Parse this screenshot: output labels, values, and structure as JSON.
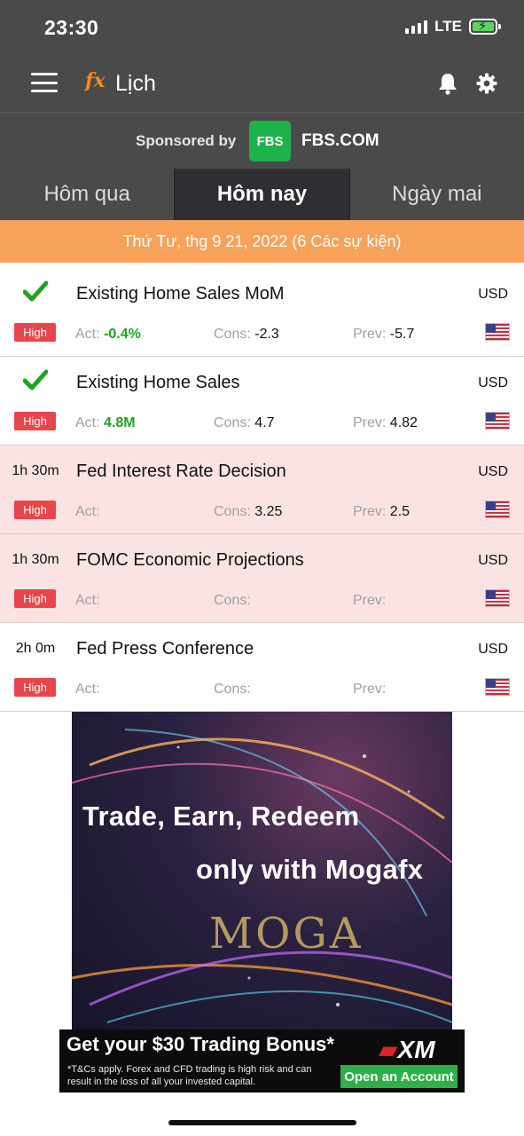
{
  "status_bar": {
    "time": "23:30",
    "network": "LTE"
  },
  "header": {
    "logo": "fx",
    "title": "Lịch"
  },
  "sponsor": {
    "text": "Sponsored by",
    "logo": "FBS",
    "name": "FBS.COM"
  },
  "tabs": [
    {
      "label": "Hôm qua",
      "active": false
    },
    {
      "label": "Hôm nay",
      "active": true
    },
    {
      "label": "Ngày mai",
      "active": false
    }
  ],
  "date_banner": "Thứ Tư, thg 9 21, 2022 (6 Các sự kiện)",
  "stat_labels": {
    "act": "Act:",
    "cons": "Cons:",
    "prev": "Prev:"
  },
  "events": [
    {
      "time": "",
      "done": true,
      "name": "Existing Home Sales MoM",
      "currency": "USD",
      "impact": "High",
      "act": "-0.4%",
      "cons": "-2.3",
      "prev": "-5.7",
      "highlight": false
    },
    {
      "time": "",
      "done": true,
      "name": "Existing Home Sales",
      "currency": "USD",
      "impact": "High",
      "act": "4.8M",
      "cons": "4.7",
      "prev": "4.82",
      "highlight": false
    },
    {
      "time": "1h 30m",
      "done": false,
      "name": "Fed Interest Rate Decision",
      "currency": "USD",
      "impact": "High",
      "act": "",
      "cons": "3.25",
      "prev": "2.5",
      "highlight": true
    },
    {
      "time": "1h 30m",
      "done": false,
      "name": "FOMC Economic Projections",
      "currency": "USD",
      "impact": "High",
      "act": "",
      "cons": "",
      "prev": "",
      "highlight": true
    },
    {
      "time": "2h 0m",
      "done": false,
      "name": "Fed Press Conference",
      "currency": "USD",
      "impact": "High",
      "act": "",
      "cons": "",
      "prev": "",
      "highlight": false
    }
  ],
  "ad_banner": {
    "line1": "Trade, Earn, Redeem",
    "line2": "only with Mogafx",
    "brand": "MOGA"
  },
  "ad_xm": {
    "headline": "Get your $30 Trading Bonus*",
    "disclaimer": "*T&Cs apply. Forex and CFD trading is high risk and can result in the loss of all your invested capital.",
    "logo": "XM",
    "cta": "Open an Account"
  },
  "colors": {
    "header_bg": "#4a4a4a",
    "banner_orange": "#f6a25a",
    "impact_high": "#e8464a",
    "positive": "#1ea31e",
    "alert_row": "#fbe3e3"
  }
}
